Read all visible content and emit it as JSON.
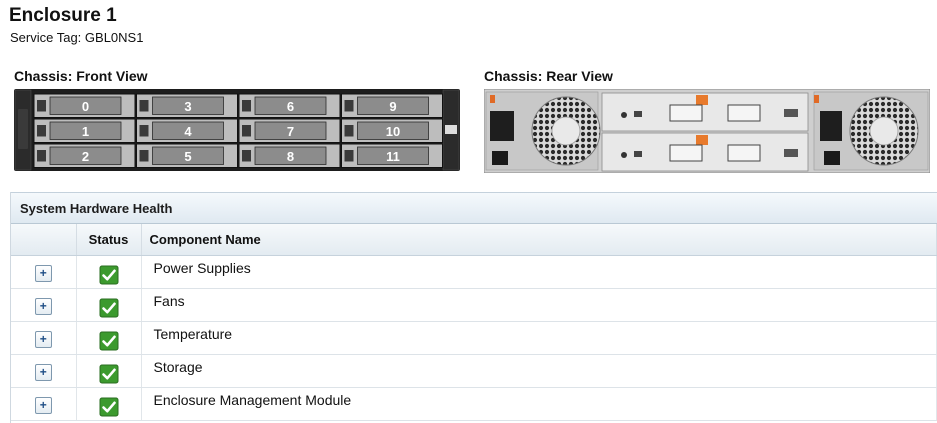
{
  "enclosure": {
    "title": "Enclosure 1",
    "service_tag": "Service Tag: GBL0NS1"
  },
  "chassis": {
    "front_label": "Chassis: Front View",
    "rear_label": "Chassis: Rear View",
    "front_bay_numbers": [
      "0",
      "1",
      "2",
      "3",
      "4",
      "5",
      "6",
      "7",
      "8",
      "9",
      "10",
      "11"
    ]
  },
  "health": {
    "title": "System Hardware Health",
    "columns": {
      "status": "Status",
      "component": "Component Name"
    },
    "expand_symbol": "+",
    "status_color": "#3c9a2e",
    "rows": [
      {
        "name": "Power Supplies",
        "status": "ok"
      },
      {
        "name": "Fans",
        "status": "ok"
      },
      {
        "name": "Temperature",
        "status": "ok"
      },
      {
        "name": "Storage",
        "status": "ok"
      },
      {
        "name": "Enclosure Management Module",
        "status": "ok"
      }
    ]
  }
}
